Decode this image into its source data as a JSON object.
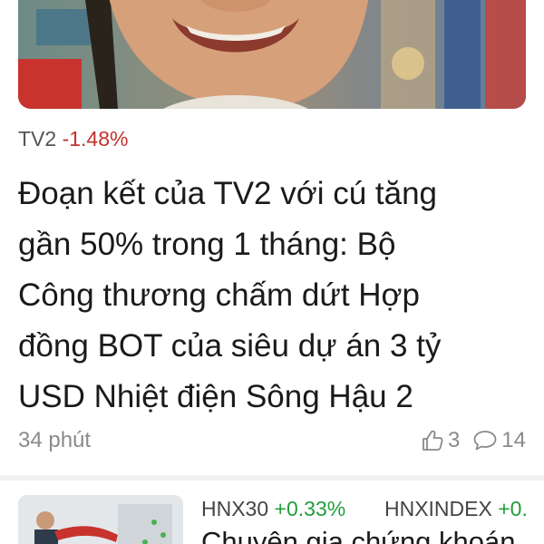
{
  "article": {
    "ticker": {
      "symbol": "TV2",
      "change": "-1.48%"
    },
    "headline_lines": [
      "Đoạn kết của TV2 với cú tăng",
      "gần 50% trong 1 tháng: Bộ",
      "Công thương chấm dứt Hợp",
      "đồng BOT của siêu dự án 3 tỷ",
      "USD Nhiệt điện Sông Hậu 2"
    ],
    "time": "34 phút",
    "likes": "3",
    "comments": "14"
  },
  "next_article": {
    "tickers": [
      {
        "symbol": "HNX30",
        "change": "+0.33%"
      },
      {
        "symbol": "HNXINDEX",
        "change": "+0."
      }
    ],
    "title_partial": "Chuyên gia chứng khoán"
  },
  "colors": {
    "negative": "#c2312f",
    "positive": "#1f9e3a",
    "muted": "#8a8a8a"
  }
}
